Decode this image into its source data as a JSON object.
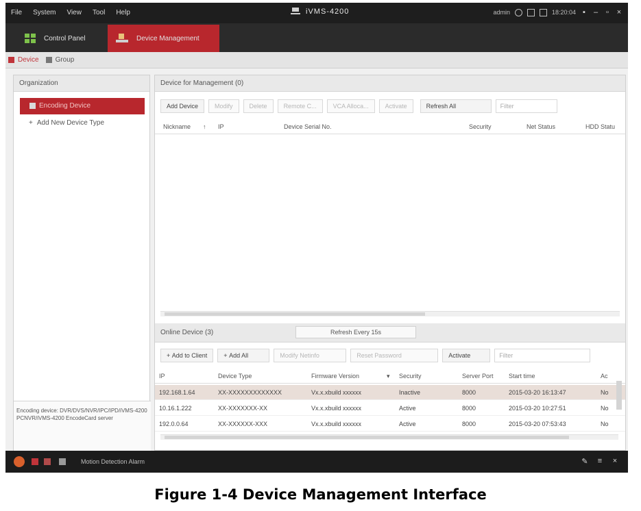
{
  "app": {
    "title": "iVMS-4200",
    "menus": [
      "File",
      "System",
      "View",
      "Tool",
      "Help"
    ],
    "status_time": "18:20:04",
    "status_label": "admin"
  },
  "modules": [
    {
      "label": "Control Panel"
    },
    {
      "label": "Device Management"
    }
  ],
  "subtabs": [
    "Device",
    "Group"
  ],
  "left": {
    "header": "Organization",
    "selected": "Encoding Device",
    "add_type": "Add New Device Type",
    "browse_info": "Encoding device: DVR/DVS/NVR/IPC/IPD/iVMS-4200 PCNVR/iVMS-4200 EncodeCard server"
  },
  "managed": {
    "header": "Device for Management (0)",
    "buttons": [
      "Add Device",
      "Modify",
      "Delete",
      "Remote C...",
      "VCA Alloca...",
      "Activate"
    ],
    "refresh": "Refresh All",
    "filter_placeholder": "Filter",
    "columns": [
      "Nickname",
      "IP",
      "Device Serial No.",
      "Security",
      "Net Status",
      "HDD Statu"
    ]
  },
  "online": {
    "header": "Online Device (3)",
    "refresh": "Refresh Every 15s",
    "buttons": [
      "Add to Client",
      "Add All",
      "Modify Netinfo",
      "Reset Password",
      "Activate"
    ],
    "filter_placeholder": "Filter",
    "columns": [
      "IP",
      "Device Type",
      "Firmware Version",
      "Security",
      "Server Port",
      "Start time",
      "Ac"
    ],
    "rows": [
      {
        "ip": "192.168.1.64",
        "type": "XX-XXXXXXXXXXXXX",
        "fw": "Vx.x.xbuild xxxxxx",
        "security": "Inactive",
        "port": "8000",
        "start": "2015-03-20 16:13:47",
        "ac": "No"
      },
      {
        "ip": "10.16.1.222",
        "type": "XX-XXXXXXX-XX",
        "fw": "Vx.x.xbuild xxxxxx",
        "security": "Active",
        "port": "8000",
        "start": "2015-03-20 10:27:51",
        "ac": "No"
      },
      {
        "ip": "192.0.0.64",
        "type": "XX-XXXXXX-XXX",
        "fw": "Vx.x.xbuild xxxxxx",
        "security": "Active",
        "port": "8000",
        "start": "2015-03-20 07:53:43",
        "ac": "No"
      }
    ]
  },
  "statusbar": {
    "alarm": "Motion Detection Alarm"
  },
  "caption": "Figure 1-4 Device Management Interface",
  "colors": {
    "accent": "#b8272d",
    "frame": "#2b2b2b"
  }
}
